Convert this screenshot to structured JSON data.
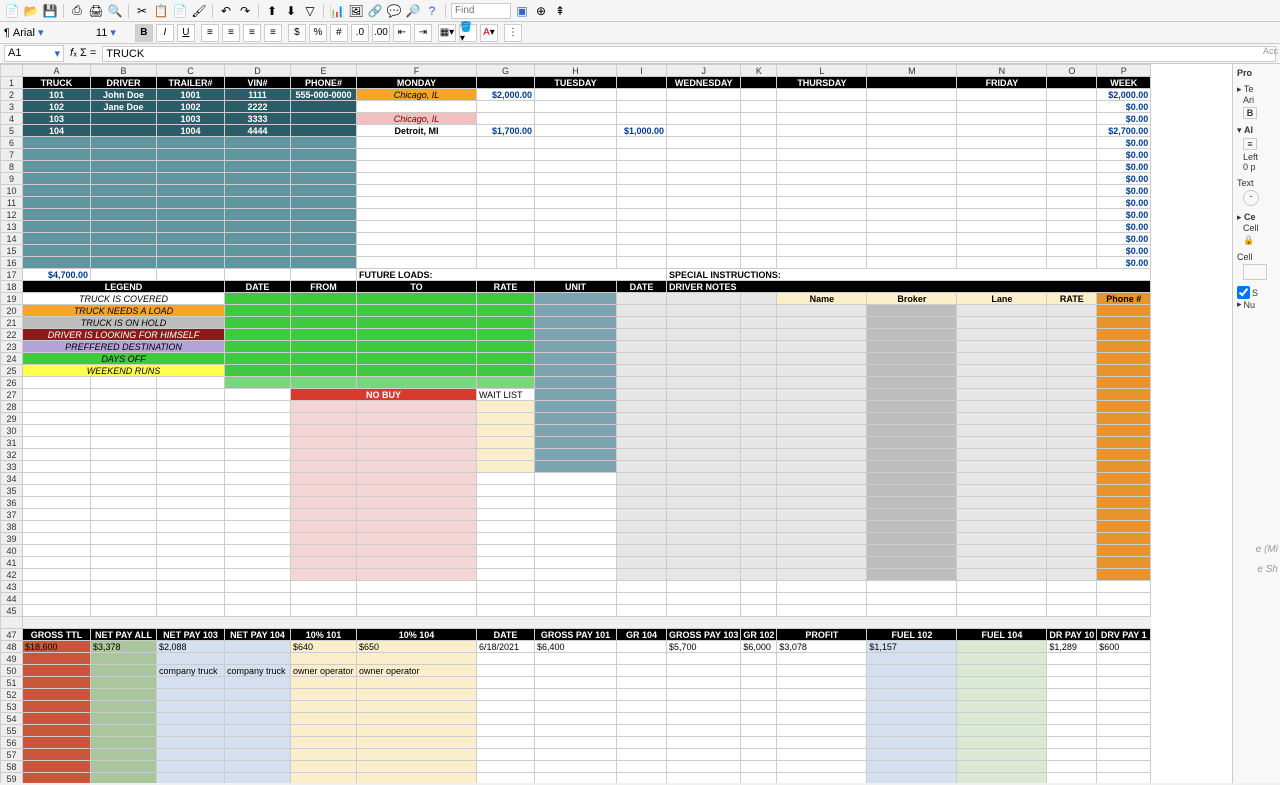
{
  "toolbar": {
    "find_placeholder": "Find"
  },
  "fmt": {
    "font": "Arial",
    "size": "11"
  },
  "formula": {
    "cell": "A1",
    "value": "TRUCK"
  },
  "cols": [
    "A",
    "B",
    "C",
    "D",
    "E",
    "F",
    "G",
    "H",
    "I",
    "J",
    "K",
    "L",
    "M",
    "N",
    "O",
    "P"
  ],
  "hdr1": [
    "TRUCK",
    "DRIVER",
    "TRAILER#",
    "VIN#",
    "PHONE#",
    "MONDAY",
    "",
    "TUESDAY",
    "",
    "WEDNESDAY",
    "",
    "THURSDAY",
    "",
    "FRIDAY",
    "",
    "WEEK"
  ],
  "trucks": [
    {
      "t": "101",
      "d": "John Doe",
      "tr": "1001",
      "v": "1111",
      "p": "555-000-0000",
      "dest": "Chicago, IL",
      "destCls": "orange",
      "g": "$2,000.00",
      "i": "",
      "wk": "$2,000.00"
    },
    {
      "t": "102",
      "d": "Jane Doe",
      "tr": "1002",
      "v": "2222",
      "p": "",
      "dest": "",
      "destCls": "",
      "g": "",
      "i": "",
      "wk": "$0.00"
    },
    {
      "t": "103",
      "d": "",
      "tr": "1003",
      "v": "3333",
      "p": "",
      "dest": "Chicago, IL",
      "destCls": "pink",
      "g": "",
      "i": "",
      "wk": "$0.00"
    },
    {
      "t": "104",
      "d": "",
      "tr": "1004",
      "v": "4444",
      "p": "",
      "dest": "Detroit, MI",
      "destCls": "center bold",
      "g": "$1,700.00",
      "i": "$1,000.00",
      "wk": "$2,700.00"
    }
  ],
  "emptyTruckWk": "$0.00",
  "totalRow": {
    "sum": "$4,700.00",
    "future": "FUTURE LOADS:",
    "special": "SPECIAL INSTRUCTIONS:"
  },
  "hdr2": {
    "legend": "LEGEND",
    "date": "DATE",
    "from": "FROM",
    "to": "TO",
    "rate": "RATE",
    "unit": "UNIT",
    "date2": "DATE",
    "notes": "DRIVER NOTES"
  },
  "legend": [
    "TRUCK IS COVERED",
    "TRUCK NEEDS A LOAD",
    "TRUCK IS ON HOLD",
    "DRIVER IS LOOKING FOR HIMSELF",
    "PREFFERED DESTINATION",
    "DAYS OFF",
    "WEEKEND RUNS"
  ],
  "legendCls": [
    "",
    "orange",
    "gray",
    "dkred",
    "purple",
    "green",
    "yellow"
  ],
  "notesHdr": [
    "Name",
    "Broker",
    "Lane",
    "RATE",
    "Phone #"
  ],
  "nobuy": "NO BUY",
  "waitlist": "WAIT LIST",
  "hdr3": [
    "GROSS TTL",
    "NET PAY ALL",
    "NET PAY  103",
    "NET PAY 104",
    "10% 101",
    "10% 104",
    "DATE",
    "GROSS PAY 101",
    "GR 104",
    "GROSS PAY 103",
    "GR 102",
    "PROFIT",
    "FUEL 102",
    "FUEL 104",
    "DR PAY 10",
    "DRV PAY 1"
  ],
  "row48": [
    "$18,600",
    "$3,378",
    "$2,088",
    "",
    "$640",
    "$650",
    "6/18/2021",
    "$6,400",
    "",
    "$5,700",
    "$6,000",
    "$3,078",
    "$1,157",
    "",
    "$1,289",
    "$600"
  ],
  "row50": [
    "",
    "",
    "company truck",
    "company truck",
    "owner operator",
    "owner operator",
    "",
    "",
    "",
    "",
    "",
    "",
    "",
    "",
    "",
    ""
  ],
  "side": {
    "pro": "Pro",
    "acc": "Acc",
    "te": "Te",
    "ari": "Ari",
    "b": "B",
    "al": "Al",
    "left": "Left",
    "pt": "0 p",
    "text": "Text",
    "ce": "Ce",
    "cell": "Cell",
    "cell2": "Cell",
    "s": "S",
    "nu": "Nu",
    "mi": "e (Mi",
    "sh": "e Sh"
  }
}
